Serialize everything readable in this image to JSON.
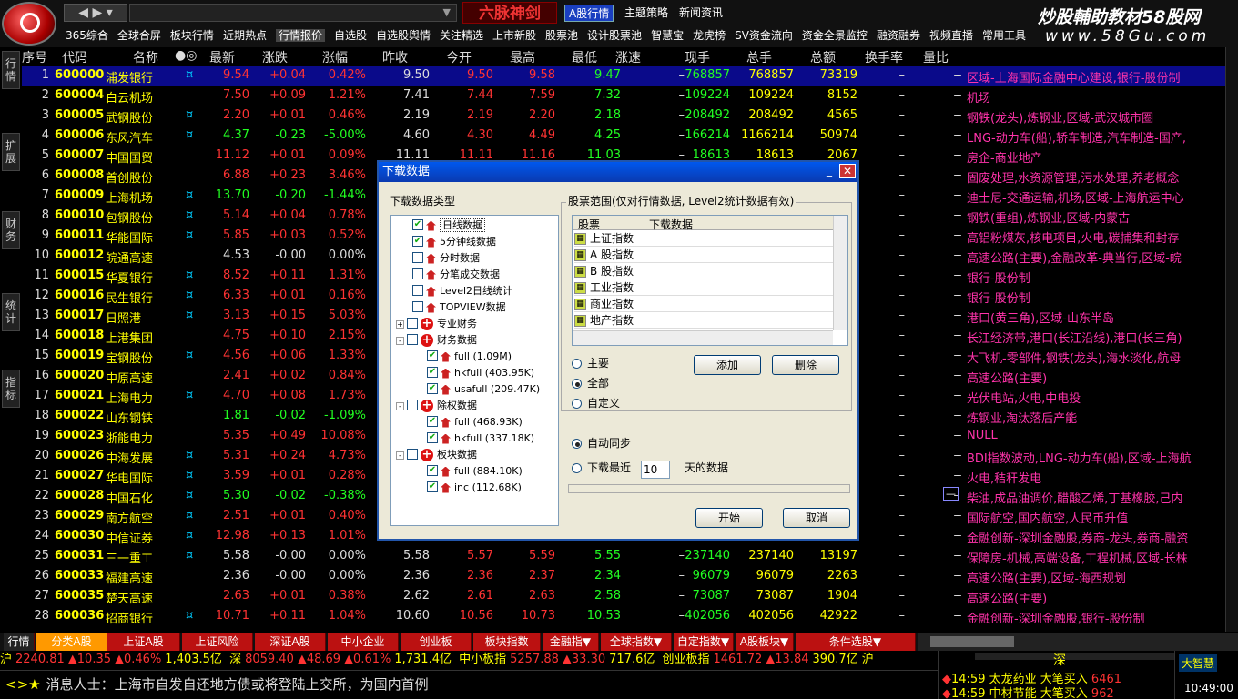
{
  "top": {
    "hot_label": "六脉神剑",
    "tabs": [
      "A股行情",
      "主题策略",
      "新闻资讯"
    ],
    "brand": "炒股輔助教材58股网",
    "brand_url": "www.58Gu.com",
    "menu": [
      "365综合",
      "全球合屏",
      "板块行情",
      "近期热点",
      "行情报价",
      "自选股",
      "自选股舆情",
      "关注精选",
      "上市新股",
      "股票池",
      "设计股票池",
      "智慧宝",
      "龙虎榜",
      "SV资金流向",
      "资金全景监控",
      "融资融券",
      "视频直播",
      "常用工具"
    ]
  },
  "vtabs": [
    "行情",
    "扩展",
    "财务",
    "统计",
    "指标"
  ],
  "columns": [
    "序号",
    "代码",
    "名称",
    "●◎",
    "最新",
    "涨跌",
    "涨幅",
    "昨收",
    "今开",
    "最高",
    "最低",
    "涨速",
    "现手",
    "总手",
    "总额",
    "换手率",
    "量比"
  ],
  "rows": [
    {
      "no": "1",
      "code": "600000",
      "name": "浦发银行",
      "mark": "¤",
      "last": "9.54",
      "chg": "+0.04",
      "pct": "0.42%",
      "prev": "9.50",
      "open": "9.50",
      "high": "9.58",
      "low": "9.47",
      "spd": "–",
      "vol": "768857",
      "tot": "768857",
      "amt": "73319",
      "turn": "–",
      "ratio": "–",
      "info": "区域-上海国际金融中心建设,银行-股份制",
      "sel": true,
      "dir": "up"
    },
    {
      "no": "2",
      "code": "600004",
      "name": "白云机场",
      "mark": "",
      "last": "7.50",
      "chg": "+0.09",
      "pct": "1.21%",
      "prev": "7.41",
      "open": "7.44",
      "high": "7.59",
      "low": "7.32",
      "spd": "–",
      "vol": "109224",
      "tot": "109224",
      "amt": "8152",
      "turn": "–",
      "ratio": "–",
      "info": "机场",
      "dir": "up"
    },
    {
      "no": "3",
      "code": "600005",
      "name": "武钢股份",
      "mark": "¤",
      "last": "2.20",
      "chg": "+0.01",
      "pct": "0.46%",
      "prev": "2.19",
      "open": "2.19",
      "high": "2.20",
      "low": "2.18",
      "spd": "–",
      "vol": "208492",
      "tot": "208492",
      "amt": "4565",
      "turn": "–",
      "ratio": "–",
      "info": "钢铁(龙头),炼钢业,区域-武汉城市圈",
      "dir": "up"
    },
    {
      "no": "4",
      "code": "600006",
      "name": "东风汽车",
      "mark": "¤",
      "last": "4.37",
      "chg": "-0.23",
      "pct": "-5.00%",
      "prev": "4.60",
      "open": "4.30",
      "high": "4.49",
      "low": "4.25",
      "spd": "–",
      "vol": "166214",
      "tot": "1166214",
      "amt": "50974",
      "turn": "–",
      "ratio": "–",
      "info": "LNG-动力车(船),轿车制造,汽车制造-国产,",
      "dir": "down"
    },
    {
      "no": "5",
      "code": "600007",
      "name": "中国国贸",
      "mark": "",
      "last": "11.12",
      "chg": "+0.01",
      "pct": "0.09%",
      "prev": "11.11",
      "open": "11.11",
      "high": "11.16",
      "low": "11.03",
      "spd": "–",
      "vol": "18613",
      "tot": "18613",
      "amt": "2067",
      "turn": "–",
      "ratio": "–",
      "info": "房企-商业地产",
      "dir": "up"
    },
    {
      "no": "6",
      "code": "600008",
      "name": "首创股份",
      "mark": "",
      "last": "6.88",
      "chg": "+0.23",
      "pct": "3.46%",
      "prev": "",
      "open": "",
      "high": "",
      "low": "",
      "spd": "",
      "vol": "",
      "tot": "",
      "amt": "",
      "turn": "–",
      "ratio": "–",
      "info": "固废处理,水资源管理,污水处理,养老概念",
      "dir": "up"
    },
    {
      "no": "7",
      "code": "600009",
      "name": "上海机场",
      "mark": "¤",
      "last": "13.70",
      "chg": "-0.20",
      "pct": "-1.44%",
      "prev": "",
      "open": "",
      "high": "",
      "low": "",
      "spd": "",
      "vol": "",
      "tot": "",
      "amt": "",
      "turn": "–",
      "ratio": "–",
      "info": "迪士尼-交通运输,机场,区域-上海航运中心",
      "dir": "down"
    },
    {
      "no": "8",
      "code": "600010",
      "name": "包钢股份",
      "mark": "¤",
      "last": "5.14",
      "chg": "+0.04",
      "pct": "0.78%",
      "prev": "",
      "open": "",
      "high": "",
      "low": "",
      "spd": "",
      "vol": "",
      "tot": "",
      "amt": "",
      "turn": "–",
      "ratio": "–",
      "info": "钢铁(重组),炼钢业,区域-内蒙古",
      "dir": "up"
    },
    {
      "no": "9",
      "code": "600011",
      "name": "华能国际",
      "mark": "¤",
      "last": "5.85",
      "chg": "+0.03",
      "pct": "0.52%",
      "prev": "",
      "open": "",
      "high": "",
      "low": "",
      "spd": "",
      "vol": "",
      "tot": "",
      "amt": "",
      "turn": "–",
      "ratio": "–",
      "info": "高铝粉煤灰,核电项目,火电,碳捕集和封存",
      "dir": "up"
    },
    {
      "no": "10",
      "code": "600012",
      "name": "皖通高速",
      "mark": "",
      "last": "4.53",
      "chg": "-0.00",
      "pct": "0.00%",
      "prev": "",
      "open": "",
      "high": "",
      "low": "",
      "spd": "",
      "vol": "",
      "tot": "",
      "amt": "",
      "turn": "–",
      "ratio": "–",
      "info": "高速公路(主要),金融改革-典当行,区域-皖",
      "dir": "flat"
    },
    {
      "no": "11",
      "code": "600015",
      "name": "华夏银行",
      "mark": "¤",
      "last": "8.52",
      "chg": "+0.11",
      "pct": "1.31%",
      "prev": "",
      "open": "",
      "high": "",
      "low": "",
      "spd": "",
      "vol": "",
      "tot": "",
      "amt": "",
      "turn": "–",
      "ratio": "–",
      "info": "银行-股份制",
      "dir": "up"
    },
    {
      "no": "12",
      "code": "600016",
      "name": "民生银行",
      "mark": "¤",
      "last": "6.33",
      "chg": "+0.01",
      "pct": "0.16%",
      "prev": "",
      "open": "",
      "high": "",
      "low": "",
      "spd": "",
      "vol": "",
      "tot": "",
      "amt": "",
      "turn": "–",
      "ratio": "–",
      "info": "银行-股份制",
      "dir": "up"
    },
    {
      "no": "13",
      "code": "600017",
      "name": "日照港",
      "mark": "¤",
      "last": "3.13",
      "chg": "+0.15",
      "pct": "5.03%",
      "prev": "",
      "open": "",
      "high": "",
      "low": "",
      "spd": "",
      "vol": "",
      "tot": "",
      "amt": "",
      "turn": "–",
      "ratio": "–",
      "info": "港口(黄三角),区域-山东半岛",
      "dir": "up"
    },
    {
      "no": "14",
      "code": "600018",
      "name": "上港集团",
      "mark": "",
      "last": "4.75",
      "chg": "+0.10",
      "pct": "2.15%",
      "prev": "",
      "open": "",
      "high": "",
      "low": "",
      "spd": "",
      "vol": "",
      "tot": "",
      "amt": "",
      "turn": "–",
      "ratio": "–",
      "info": "长江经济带,港口(长江沿线),港口(长三角)",
      "dir": "up"
    },
    {
      "no": "15",
      "code": "600019",
      "name": "宝钢股份",
      "mark": "¤",
      "last": "4.56",
      "chg": "+0.06",
      "pct": "1.33%",
      "prev": "",
      "open": "",
      "high": "",
      "low": "",
      "spd": "",
      "vol": "",
      "tot": "",
      "amt": "",
      "turn": "–",
      "ratio": "–",
      "info": "大飞机-零部件,钢铁(龙头),海水淡化,航母",
      "dir": "up"
    },
    {
      "no": "16",
      "code": "600020",
      "name": "中原高速",
      "mark": "",
      "last": "2.41",
      "chg": "+0.02",
      "pct": "0.84%",
      "prev": "",
      "open": "",
      "high": "",
      "low": "",
      "spd": "",
      "vol": "",
      "tot": "",
      "amt": "",
      "turn": "–",
      "ratio": "–",
      "info": "高速公路(主要)",
      "dir": "up"
    },
    {
      "no": "17",
      "code": "600021",
      "name": "上海电力",
      "mark": "¤",
      "last": "4.70",
      "chg": "+0.08",
      "pct": "1.73%",
      "prev": "",
      "open": "",
      "high": "",
      "low": "",
      "spd": "",
      "vol": "",
      "tot": "",
      "amt": "",
      "turn": "–",
      "ratio": "–",
      "info": "光伏电站,火电,中电投",
      "dir": "up"
    },
    {
      "no": "18",
      "code": "600022",
      "name": "山东钢铁",
      "mark": "",
      "last": "1.81",
      "chg": "-0.02",
      "pct": "-1.09%",
      "prev": "",
      "open": "",
      "high": "",
      "low": "",
      "spd": "",
      "vol": "",
      "tot": "",
      "amt": "",
      "turn": "–",
      "ratio": "–",
      "info": "炼钢业,淘汰落后产能",
      "dir": "down"
    },
    {
      "no": "19",
      "code": "600023",
      "name": "浙能电力",
      "mark": "",
      "last": "5.35",
      "chg": "+0.49",
      "pct": "10.08%",
      "prev": "",
      "open": "",
      "high": "",
      "low": "",
      "spd": "",
      "vol": "",
      "tot": "",
      "amt": "",
      "turn": "–",
      "ratio": "–",
      "info": "NULL",
      "dir": "up"
    },
    {
      "no": "20",
      "code": "600026",
      "name": "中海发展",
      "mark": "¤",
      "last": "5.31",
      "chg": "+0.24",
      "pct": "4.73%",
      "prev": "",
      "open": "",
      "high": "",
      "low": "",
      "spd": "",
      "vol": "",
      "tot": "",
      "amt": "",
      "turn": "–",
      "ratio": "–",
      "info": "BDI指数波动,LNG-动力车(船),区域-上海航",
      "dir": "up"
    },
    {
      "no": "21",
      "code": "600027",
      "name": "华电国际",
      "mark": "¤",
      "last": "3.59",
      "chg": "+0.01",
      "pct": "0.28%",
      "prev": "",
      "open": "",
      "high": "",
      "low": "",
      "spd": "",
      "vol": "",
      "tot": "",
      "amt": "",
      "turn": "–",
      "ratio": "–",
      "info": "火电,秸秆发电",
      "dir": "up"
    },
    {
      "no": "22",
      "code": "600028",
      "name": "中国石化",
      "mark": "¤",
      "last": "5.30",
      "chg": "-0.02",
      "pct": "-0.38%",
      "prev": "",
      "open": "",
      "high": "",
      "low": "",
      "spd": "",
      "vol": "",
      "tot": "",
      "amt": "",
      "turn": "–",
      "ratio": "–",
      "info": "柴油,成品油调价,醋酸乙烯,丁基橡胶,己内",
      "dir": "down",
      "infobox": true
    },
    {
      "no": "23",
      "code": "600029",
      "name": "南方航空",
      "mark": "¤",
      "last": "2.51",
      "chg": "+0.01",
      "pct": "0.40%",
      "prev": "",
      "open": "",
      "high": "",
      "low": "",
      "spd": "",
      "vol": "",
      "tot": "",
      "amt": "",
      "turn": "–",
      "ratio": "–",
      "info": "国际航空,国内航空,人民币升值",
      "dir": "up"
    },
    {
      "no": "24",
      "code": "600030",
      "name": "中信证券",
      "mark": "¤",
      "last": "12.98",
      "chg": "+0.13",
      "pct": "1.01%",
      "prev": "",
      "open": "",
      "high": "",
      "low": "",
      "spd": "",
      "vol": "",
      "tot": "",
      "amt": "",
      "turn": "–",
      "ratio": "–",
      "info": "金融创新-深圳金融股,券商-龙头,券商-融资",
      "dir": "up"
    },
    {
      "no": "25",
      "code": "600031",
      "name": "三一重工",
      "mark": "¤",
      "last": "5.58",
      "chg": "-0.00",
      "pct": "0.00%",
      "prev": "5.58",
      "open": "5.57",
      "high": "5.59",
      "low": "5.55",
      "spd": "–",
      "vol": "237140",
      "tot": "237140",
      "amt": "13197",
      "turn": "–",
      "ratio": "–",
      "info": "保障房-机械,高端设备,工程机械,区域-长株",
      "dir": "flat"
    },
    {
      "no": "26",
      "code": "600033",
      "name": "福建高速",
      "mark": "",
      "last": "2.36",
      "chg": "-0.00",
      "pct": "0.00%",
      "prev": "2.36",
      "open": "2.36",
      "high": "2.37",
      "low": "2.34",
      "spd": "–",
      "vol": "96079",
      "tot": "96079",
      "amt": "2263",
      "turn": "–",
      "ratio": "–",
      "info": "高速公路(主要),区域-海西规划",
      "dir": "flat"
    },
    {
      "no": "27",
      "code": "600035",
      "name": "楚天高速",
      "mark": "",
      "last": "2.63",
      "chg": "+0.01",
      "pct": "0.38%",
      "prev": "2.62",
      "open": "2.61",
      "high": "2.63",
      "low": "2.58",
      "spd": "–",
      "vol": "73087",
      "tot": "73087",
      "amt": "1904",
      "turn": "–",
      "ratio": "–",
      "info": "高速公路(主要)",
      "dir": "up"
    },
    {
      "no": "28",
      "code": "600036",
      "name": "招商银行",
      "mark": "¤",
      "last": "10.71",
      "chg": "+0.11",
      "pct": "1.04%",
      "prev": "10.60",
      "open": "10.56",
      "high": "10.73",
      "low": "10.53",
      "spd": "–",
      "vol": "402056",
      "tot": "402056",
      "amt": "42922",
      "turn": "–",
      "ratio": "–",
      "info": "金融创新-深圳金融股,银行-股份制",
      "dir": "up"
    }
  ],
  "bottom_tabs": [
    "行情",
    "分类A股",
    "上证A股",
    "上证风险",
    "深证A股",
    "中小企业",
    "创业板",
    "板块指数",
    "金融指▼",
    "全球指数▼",
    "自定指数▼",
    "A股板块▼",
    "条件选股▼"
  ],
  "ticker": {
    "sh_label": "沪",
    "sh_val": "2240.81",
    "sh_chg": "▲10.35",
    "sh_pct": "▲0.46%",
    "sh_amt": "1,403.5亿",
    "sz_label": "深",
    "sz_val": "8059.40",
    "sz_chg": "▲48.69",
    "sz_pct": "▲0.61%",
    "sz_amt": "1,731.4亿",
    "zx_label": "中小板指",
    "zx_val": "5257.88",
    "zx_chg": "▲33.30",
    "zx_amt": "717.6亿",
    "cy_label": "创业板指",
    "cy_val": "1461.72",
    "cy_chg": "▲13.84",
    "cy_amt": "390.7亿",
    "tail": "沪"
  },
  "message": {
    "icons": "<>★",
    "text": "消息人士：上海市自发自还地方债或将登陆上交所，为国内首例"
  },
  "right_panel": {
    "market": "深",
    "l1_time": "14:59",
    "l1_name": "太龙药业",
    "l1_act": "大笔买入",
    "l1_val": "6461",
    "l2_time": "14:59",
    "l2_name": "中材节能",
    "l2_act": "大笔买入",
    "l2_val": "962"
  },
  "clock": {
    "badge": "大智慧",
    "time": "10:49:00"
  },
  "dialog": {
    "title": "下载数据",
    "type_label": "下载数据类型",
    "range_label": "股票范围(仅对行情数据, Level2统计数据有效)",
    "tree": [
      {
        "label": "日线数据",
        "level": 1,
        "checked": true,
        "icon": "file",
        "selected": true
      },
      {
        "label": "5分钟线数据",
        "level": 1,
        "checked": true,
        "icon": "file"
      },
      {
        "label": "分时数据",
        "level": 1,
        "checked": false,
        "icon": "file"
      },
      {
        "label": "分笔成交数据",
        "level": 1,
        "checked": false,
        "icon": "file"
      },
      {
        "label": "Level2日线统计",
        "level": 1,
        "checked": false,
        "icon": "file"
      },
      {
        "label": "TOPVIEW数据",
        "level": 1,
        "checked": false,
        "icon": "file"
      },
      {
        "label": "专业财务",
        "level": 0,
        "checked": false,
        "icon": "red",
        "exp": "+"
      },
      {
        "label": "财务数据",
        "level": 0,
        "checked": false,
        "icon": "red",
        "exp": "-"
      },
      {
        "label": "full (1.09M)",
        "level": 2,
        "checked": true,
        "icon": "file"
      },
      {
        "label": "hkfull (403.95K)",
        "level": 2,
        "checked": true,
        "icon": "file"
      },
      {
        "label": "usafull (209.47K)",
        "level": 2,
        "checked": true,
        "icon": "file"
      },
      {
        "label": "除权数据",
        "level": 0,
        "checked": false,
        "icon": "red",
        "exp": "-"
      },
      {
        "label": "full (468.93K)",
        "level": 2,
        "checked": true,
        "icon": "file"
      },
      {
        "label": "hkfull (337.18K)",
        "level": 2,
        "checked": true,
        "icon": "file"
      },
      {
        "label": "板块数据",
        "level": 0,
        "checked": false,
        "icon": "red",
        "exp": "-"
      },
      {
        "label": "full (884.10K)",
        "level": 2,
        "checked": true,
        "icon": "file"
      },
      {
        "label": "inc (112.68K)",
        "level": 2,
        "checked": true,
        "icon": "file"
      }
    ],
    "list_cols": [
      "股票",
      "下载数据"
    ],
    "list_rows": [
      "上证指数",
      "A 股指数",
      "B 股指数",
      "工业指数",
      "商业指数",
      "地产指数"
    ],
    "radio_main": "主要",
    "radio_all": "全部",
    "radio_custom": "自定义",
    "btn_add": "添加",
    "btn_del": "删除",
    "auto_sync": "自动同步",
    "recent": "下载最近",
    "days": "10",
    "days_suffix": "天的数据",
    "btn_start": "开始",
    "btn_cancel": "取消"
  },
  "colors": {
    "up": "#ff3333",
    "down": "#22ff22",
    "code": "#ffff00",
    "info": "#ff33aa",
    "select": "#0a0a8a"
  }
}
